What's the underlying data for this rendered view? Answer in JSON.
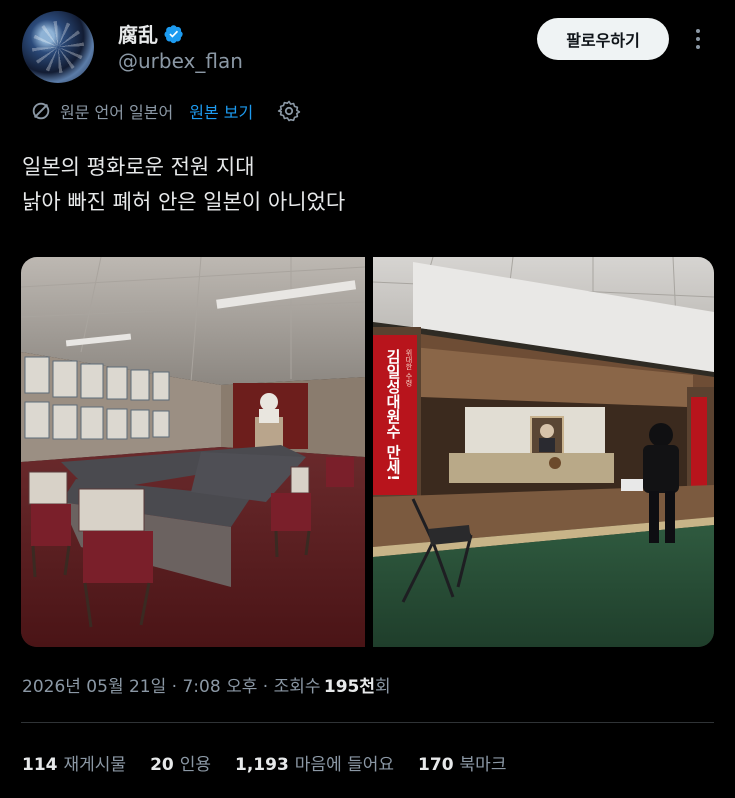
{
  "user": {
    "display_name": "腐乱",
    "handle": "@urbex_flan",
    "verified_icon": "verified-badge-icon",
    "follow_label": "팔로우하기",
    "more_icon": "more-vertical-icon"
  },
  "translation": {
    "icon": "translate-icon",
    "source_text": "원문 언어 일본어",
    "link_text": "원본 보기",
    "settings_icon": "gear-icon"
  },
  "tweet": {
    "line1": "일본의 평화로운 전원 지대",
    "line2": "낡아 빠진 폐허 안은 일본이 아니었다"
  },
  "photo_banner": {
    "slogan": "김일성대원수 만세!",
    "small_text": "위대한 수령"
  },
  "meta": {
    "date": "2026년 05월 21일",
    "time": "7:08 오후",
    "views_label": "조회수",
    "views_value": "195천",
    "views_suffix": "회",
    "sep": " · "
  },
  "stats": {
    "reposts_value": "114",
    "reposts_label": "재게시물",
    "quotes_value": "20",
    "quotes_label": "인용",
    "likes_value": "1,193",
    "likes_label": "마음에 들어요",
    "bookmarks_value": "170",
    "bookmarks_label": "북마크"
  },
  "colors": {
    "accent": "#1d9bf0",
    "muted": "#8b98a5",
    "text": "#e7e9ea",
    "background": "#000000"
  }
}
